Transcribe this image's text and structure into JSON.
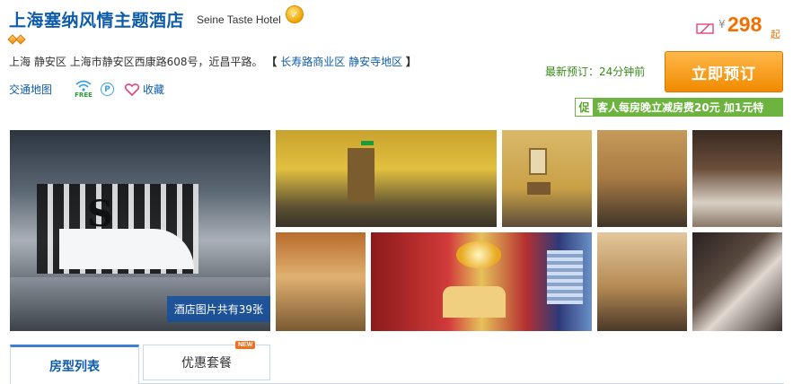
{
  "hotel": {
    "name": "上海塞纳风情主题酒店",
    "name_en": "Seine Taste Hotel",
    "address_prefix": "上海 静安区 上海市静安区西康路608号，近昌平路。",
    "bracket_open": "【",
    "area_1": "长寿路商业区",
    "area_2": "静安寺地区",
    "bracket_close": "】"
  },
  "actions": {
    "map_label": "交通地图",
    "wifi_free": "FREE",
    "parking": "P",
    "favorite_label": "收藏"
  },
  "booking": {
    "currency": "¥",
    "price": "298",
    "price_suffix": "起",
    "recent_order": "最新预订：24分钟前",
    "book_label": "立即预订",
    "promo_tag": "促",
    "promo_text": "客人每房晚立减房费20元 加1元特"
  },
  "gallery": {
    "photo_count_label": "酒店图片共有39张",
    "main_sign": "S"
  },
  "tabs": [
    {
      "label": "房型列表",
      "active": true
    },
    {
      "label": "优惠套餐",
      "badge": "NEW"
    }
  ],
  "colors": {
    "title_blue": "#0f5cab",
    "price_orange": "#f27000",
    "promo_green": "#6db33f",
    "button_orange": "#f08a00"
  },
  "icons": [
    "medal-icon",
    "diamond-icon",
    "wifi-icon",
    "parking-icon",
    "heart-icon",
    "ticket-icon"
  ]
}
